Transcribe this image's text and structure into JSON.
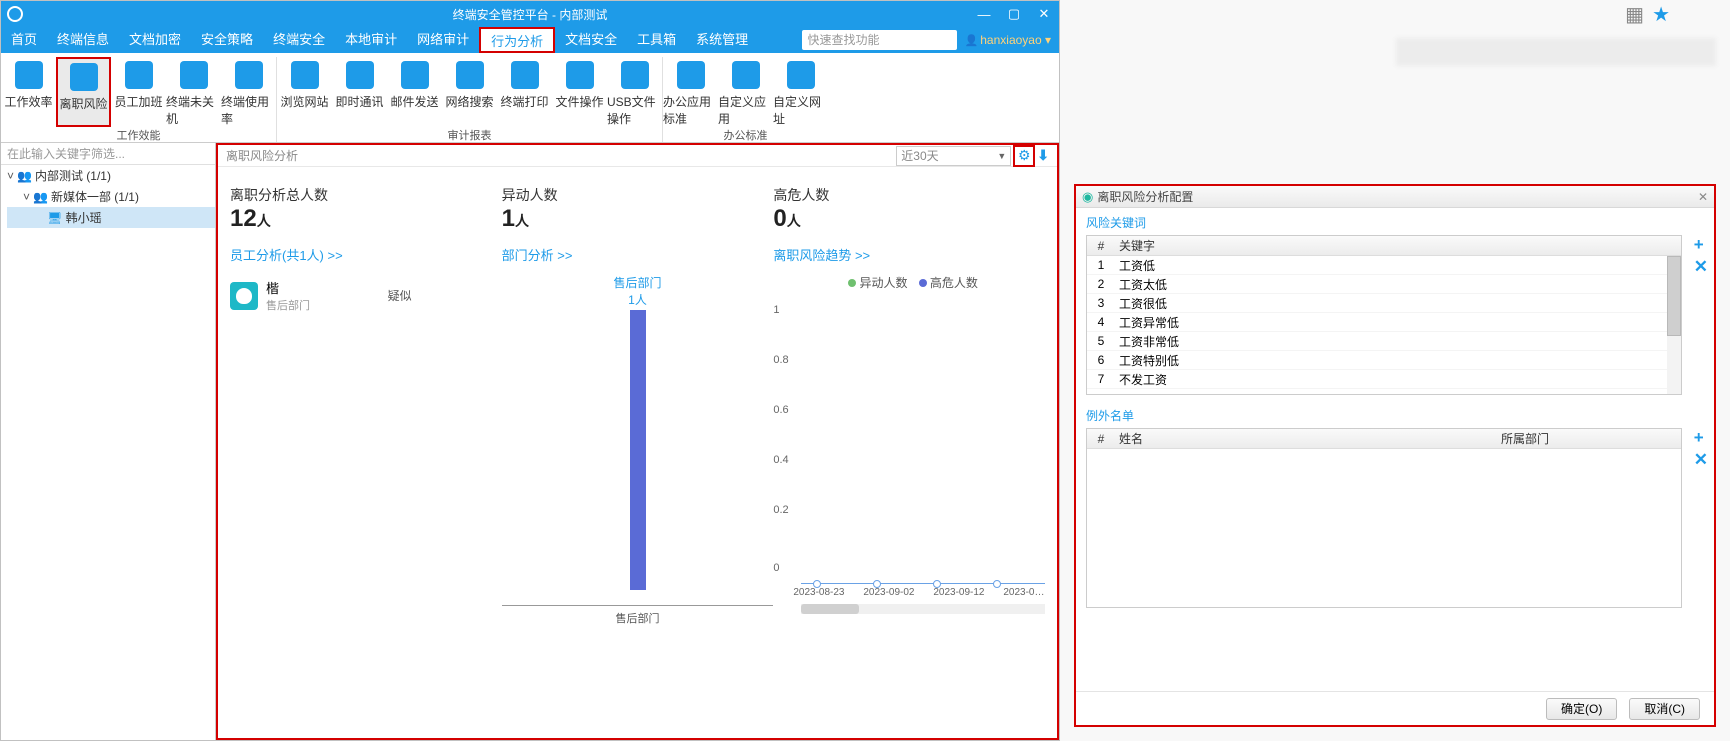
{
  "titlebar": {
    "title": "终端安全管控平台 - 内部测试"
  },
  "menubar": {
    "tabs": [
      "首页",
      "终端信息",
      "文档加密",
      "安全策略",
      "终端安全",
      "本地审计",
      "网络审计",
      "行为分析",
      "文档安全",
      "工具箱",
      "系统管理"
    ],
    "active_index": 7,
    "search_placeholder": "快速查找功能",
    "user": "hanxiaoyao"
  },
  "ribbon": {
    "groups": [
      {
        "label": "工作效能",
        "buttons": [
          "工作效率",
          "离职风险",
          "员工加班",
          "终端未关机",
          "终端使用率"
        ],
        "active_index": 1
      },
      {
        "label": "审计报表",
        "buttons": [
          "浏览网站",
          "即时通讯",
          "邮件发送",
          "网络搜索",
          "终端打印",
          "文件操作",
          "USB文件操作"
        ]
      },
      {
        "label": "办公标准",
        "buttons": [
          "办公应用标准",
          "自定义应用",
          "自定义网址"
        ]
      }
    ]
  },
  "tree": {
    "filter_placeholder": "在此输入关键字筛选...",
    "nodes": [
      {
        "label": "内部测试 (1/1)",
        "kind": "group"
      },
      {
        "label": "新媒体一部 (1/1)",
        "kind": "group",
        "indent": 1
      },
      {
        "label": "韩小瑶",
        "kind": "pc",
        "indent": 2,
        "selected": true
      }
    ]
  },
  "main": {
    "crumb": "离职风险分析",
    "range": "近30天",
    "stats": [
      {
        "label": "离职分析总人数",
        "value": "12",
        "unit": "人"
      },
      {
        "label": "异动人数",
        "value": "1",
        "unit": "人"
      },
      {
        "label": "高危人数",
        "value": "0",
        "unit": "人"
      }
    ],
    "employee_link": "员工分析(共1人) >>",
    "dept_link": "部门分析 >>",
    "trend_link": "离职风险趋势 >>",
    "employee": {
      "name": "楷",
      "dept": "售后部门",
      "tag": "疑似"
    },
    "dept_chart": {
      "label": "售后部门",
      "value": "1人",
      "xaxis": "售后部门"
    },
    "trend": {
      "legend": [
        {
          "name": "异动人数",
          "color": "#6fc06f"
        },
        {
          "name": "高危人数",
          "color": "#5a6bd6"
        }
      ],
      "yticks": [
        "1",
        "0.8",
        "0.6",
        "0.4",
        "0.2",
        "0"
      ],
      "xticks": [
        "2023-08-23",
        "2023-09-02",
        "2023-09-12",
        "2023-0…"
      ]
    }
  },
  "config": {
    "title": "离职风险分析配置",
    "kw_title": "风险关键词",
    "kw_headers": [
      "#",
      "关键字"
    ],
    "keywords": [
      "工资低",
      "工资太低",
      "工资很低",
      "工资异常低",
      "工资非常低",
      "工资特别低",
      "不发工资"
    ],
    "ex_title": "例外名单",
    "ex_headers": [
      "#",
      "姓名",
      "所属部门"
    ],
    "ok": "确定(O)",
    "cancel": "取消(C)"
  },
  "chart_data": [
    {
      "type": "bar",
      "title": "部门分析",
      "categories": [
        "售后部门"
      ],
      "values": [
        1
      ],
      "ylabel": "人",
      "ylim": [
        0,
        1
      ]
    },
    {
      "type": "line",
      "title": "离职风险趋势",
      "x": [
        "2023-08-23",
        "2023-09-02",
        "2023-09-12"
      ],
      "series": [
        {
          "name": "异动人数",
          "values": [
            0,
            0,
            0
          ]
        },
        {
          "name": "高危人数",
          "values": [
            0,
            0,
            0
          ]
        }
      ],
      "ylim": [
        0,
        1
      ]
    }
  ]
}
